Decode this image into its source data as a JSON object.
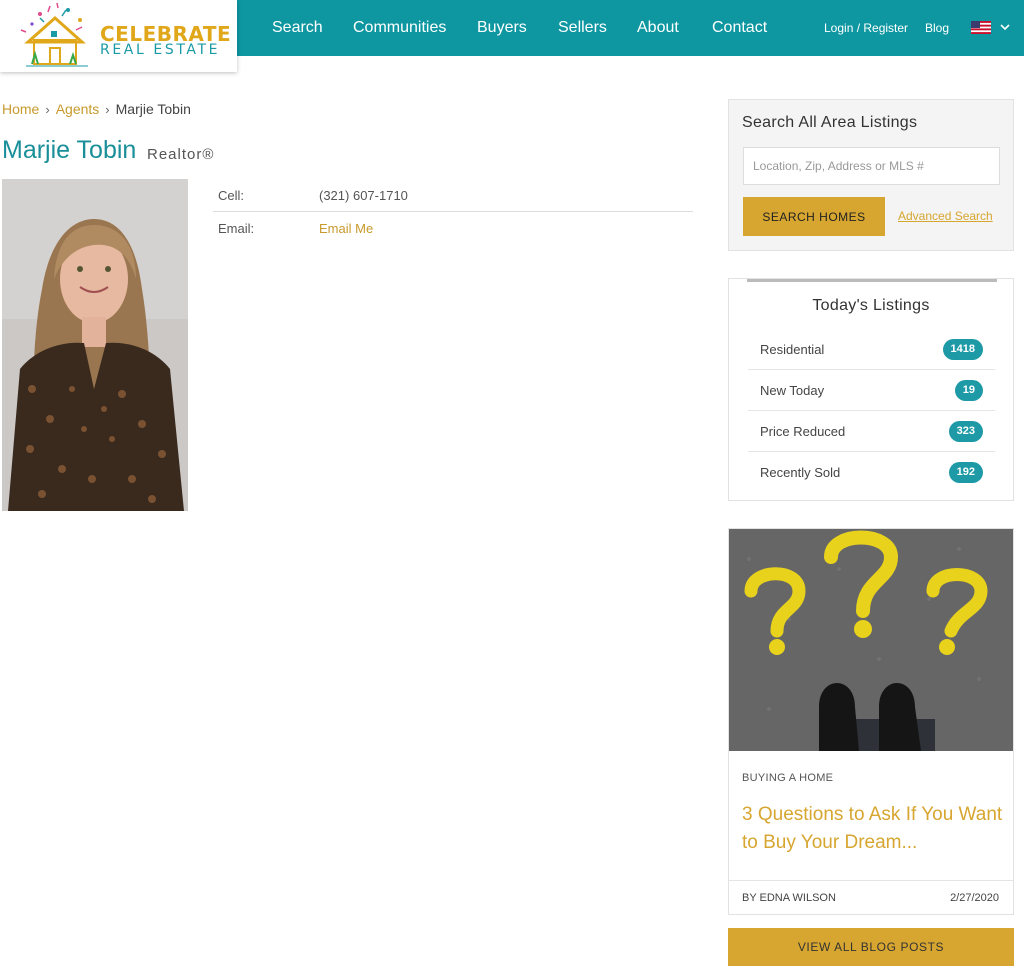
{
  "brand": {
    "name_line1": "CELEBRATE",
    "name_line2": "REAL ESTATE",
    "colors": {
      "teal": "#0e97a1",
      "gold": "#d7a630"
    }
  },
  "nav": {
    "items": [
      "Search",
      "Communities",
      "Buyers",
      "Sellers",
      "About",
      "Contact"
    ],
    "login": "Login / Register",
    "blog": "Blog",
    "flag_icon": "us-flag-icon"
  },
  "breadcrumb": {
    "home": "Home",
    "agents": "Agents",
    "current": "Marjie Tobin"
  },
  "agent": {
    "name": "Marjie Tobin",
    "title": "Realtor®",
    "cell_label": "Cell:",
    "cell_value": "(321) 607-1710",
    "email_label": "Email:",
    "email_value": "Email Me"
  },
  "search": {
    "title": "Search All Area Listings",
    "placeholder": "Location, Zip, Address or MLS #",
    "button": "SEARCH HOMES",
    "advanced": "Advanced Search"
  },
  "listings": {
    "title": "Today's Listings",
    "rows": [
      {
        "label": "Residential",
        "count": "1418"
      },
      {
        "label": "New Today",
        "count": "19"
      },
      {
        "label": "Price Reduced",
        "count": "323"
      },
      {
        "label": "Recently Sold",
        "count": "192"
      }
    ]
  },
  "blog": {
    "category": "BUYING A HOME",
    "title": "3 Questions to Ask If You Want to Buy Your Dream...",
    "author": "BY EDNA WILSON",
    "date": "2/27/2020",
    "view_all": "VIEW ALL BLOG POSTS"
  }
}
